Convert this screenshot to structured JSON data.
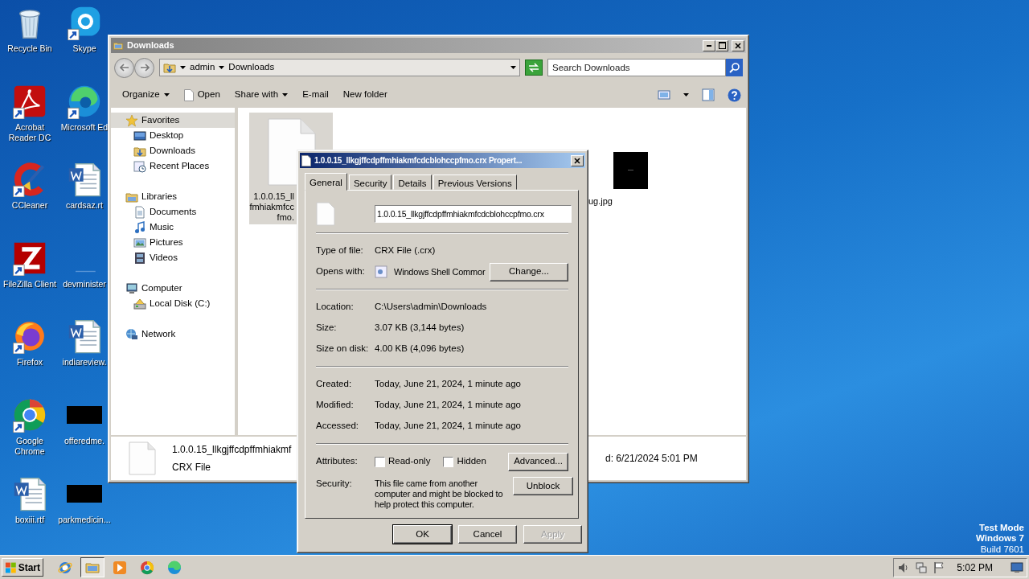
{
  "desktop_icons": [
    {
      "label": [
        "Recycle Bin"
      ],
      "kind": "recycle",
      "shortcut": false
    },
    {
      "label": [
        "Acrobat",
        "Reader DC"
      ],
      "kind": "acrobat",
      "shortcut": true
    },
    {
      "label": [
        "CCleaner"
      ],
      "kind": "ccleaner",
      "shortcut": true
    },
    {
      "label": [
        "FileZilla Client"
      ],
      "kind": "filezilla",
      "shortcut": true
    },
    {
      "label": [
        "Firefox"
      ],
      "kind": "firefox",
      "shortcut": true
    },
    {
      "label": [
        "Google",
        "Chrome"
      ],
      "kind": "chrome",
      "shortcut": true
    },
    {
      "label": [
        "boxiii.rtf"
      ],
      "kind": "word",
      "shortcut": false
    },
    {
      "label": [
        "Skype"
      ],
      "kind": "skype",
      "shortcut": true
    },
    {
      "label": [
        "Microsoft Ed"
      ],
      "kind": "edge",
      "shortcut": true
    },
    {
      "label": [
        "cardsaz.rt"
      ],
      "kind": "word",
      "shortcut": false
    },
    {
      "label": [
        "devminister"
      ],
      "kind": "blank",
      "shortcut": false
    },
    {
      "label": [
        "indiareview."
      ],
      "kind": "word",
      "shortcut": false
    },
    {
      "label": [
        "offeredme."
      ],
      "kind": "redacted",
      "shortcut": false
    },
    {
      "label": [
        "parkmedicin..."
      ],
      "kind": "redacted",
      "shortcut": false
    }
  ],
  "explorer": {
    "title": "Downloads",
    "breadcrumb": [
      "admin",
      "Downloads"
    ],
    "search": {
      "placeholder": "Search Downloads"
    },
    "toolbar": [
      {
        "label": "Organize",
        "kind": "menu"
      },
      {
        "label": "Open",
        "kind": "file"
      },
      {
        "label": "Share with",
        "kind": "menu"
      },
      {
        "label": "E-mail",
        "kind": "plain"
      },
      {
        "label": "New folder",
        "kind": "plain"
      }
    ],
    "sidebar": [
      {
        "label": "Favorites",
        "kind": "star",
        "selected": true,
        "children": [
          {
            "label": "Desktop",
            "kind": "desktop",
            "selected": false
          },
          {
            "label": "Downloads",
            "kind": "downloads",
            "selected": false
          },
          {
            "label": "Recent Places",
            "kind": "recent",
            "selected": false
          }
        ]
      },
      {
        "label": "Libraries",
        "kind": "library",
        "selected": false,
        "children": [
          {
            "label": "Documents",
            "kind": "documents",
            "selected": false
          },
          {
            "label": "Music",
            "kind": "music",
            "selected": false
          },
          {
            "label": "Pictures",
            "kind": "pictures",
            "selected": false
          },
          {
            "label": "Videos",
            "kind": "videos",
            "selected": false
          }
        ]
      },
      {
        "label": "Computer",
        "kind": "computer",
        "selected": false,
        "children": [
          {
            "label": "Local Disk (C:)",
            "kind": "disk",
            "selected": false
          }
        ]
      },
      {
        "label": "Network",
        "kind": "network",
        "selected": false
      }
    ],
    "files": [
      {
        "lines": [
          "1.0.0.15_ll",
          "fmhiakmfcc",
          "fmo."
        ],
        "kind": "file",
        "selected": true
      },
      {
        "lines": [
          "ug.jpg"
        ],
        "kind": "image",
        "selected": false
      }
    ],
    "details": {
      "name": "1.0.0.15_llkgjffcdpffmhiakmf",
      "type": "CRX File",
      "date": "d: 6/21/2024 5:01 PM"
    }
  },
  "dialog": {
    "title": "1.0.0.15_llkgjffcdpffmhiakmfcdcblohccpfmo.crx Propert...",
    "tabs": [
      {
        "label": "General",
        "selected": true
      },
      {
        "label": "Security",
        "selected": false
      },
      {
        "label": "Details",
        "selected": false
      },
      {
        "label": "Previous Versions",
        "selected": false
      }
    ],
    "filename": "1.0.0.15_llkgjffcdpffmhiakmfcdcblohccpfmo.crx",
    "sections": [
      [
        {
          "label": "Type of file:",
          "kind": "text",
          "value": "CRX File (.crx)"
        },
        {
          "label": "Opens with:",
          "kind": "app",
          "value": "Windows Shell Commor",
          "button": "Change..."
        }
      ],
      [
        {
          "label": "Location:",
          "kind": "text",
          "value": "C:\\Users\\admin\\Downloads"
        },
        {
          "label": "Size:",
          "kind": "text",
          "value": "3.07 KB (3,144 bytes)"
        },
        {
          "label": "Size on disk:",
          "kind": "text",
          "value": "4.00 KB (4,096 bytes)"
        }
      ],
      [
        {
          "label": "Created:",
          "kind": "text",
          "value": "Today, June 21, 2024, 1 minute ago"
        },
        {
          "label": "Modified:",
          "kind": "text",
          "value": "Today, June 21, 2024, 1 minute ago"
        },
        {
          "label": "Accessed:",
          "kind": "text",
          "value": "Today, June 21, 2024, 1 minute ago"
        }
      ],
      [
        {
          "label": "Attributes:",
          "kind": "attributes",
          "checks": [
            {
              "label": "Read-only",
              "checked": false
            },
            {
              "label": "Hidden",
              "checked": false
            }
          ],
          "button": "Advanced..."
        },
        {
          "label": "Security:",
          "kind": "note",
          "value": "This file came from another computer and might be blocked to help protect this computer.",
          "button": "Unblock"
        }
      ]
    ],
    "buttons": [
      {
        "label": "OK",
        "default": true,
        "disabled": false
      },
      {
        "label": "Cancel",
        "default": false,
        "disabled": false
      },
      {
        "label": "Apply",
        "default": false,
        "disabled": true
      }
    ]
  },
  "taskbar": {
    "start": "Start",
    "apps": [
      {
        "kind": "ie",
        "selected": false
      },
      {
        "kind": "folder",
        "selected": true
      },
      {
        "kind": "media",
        "selected": false
      },
      {
        "kind": "chrome",
        "selected": false
      },
      {
        "kind": "edge",
        "selected": false
      }
    ],
    "time": "5:02 PM"
  },
  "system_notice": [
    {
      "text": "Test Mode",
      "bold": true
    },
    {
      "text": "Windows 7",
      "bold": true
    },
    {
      "text": "Build 7601",
      "bold": false
    }
  ]
}
